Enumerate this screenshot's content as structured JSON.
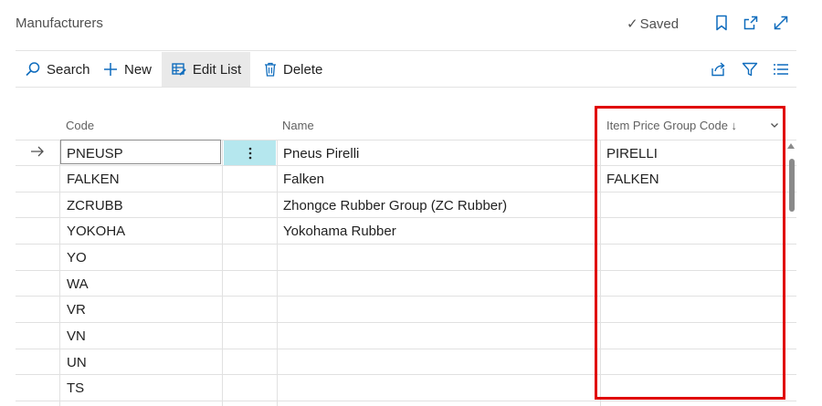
{
  "page": {
    "title": "Manufacturers",
    "saved_label": "Saved"
  },
  "toolbar": {
    "search_label": "Search",
    "new_label": "New",
    "edit_list_label": "Edit List",
    "delete_label": "Delete"
  },
  "table": {
    "columns": {
      "code": "Code",
      "name": "Name",
      "item_price_group_code": "Item Price Group Code ↓"
    },
    "rows": [
      {
        "code": "PNEUSP",
        "name": "Pneus Pirelli",
        "item_price_group_code": "PIRELLI"
      },
      {
        "code": "FALKEN",
        "name": "Falken",
        "item_price_group_code": "FALKEN"
      },
      {
        "code": "ZCRUBB",
        "name": "Zhongce Rubber Group (ZC Rubber)",
        "item_price_group_code": ""
      },
      {
        "code": "YOKOHA",
        "name": "Yokohama Rubber",
        "item_price_group_code": ""
      },
      {
        "code": "YO",
        "name": "",
        "item_price_group_code": ""
      },
      {
        "code": "WA",
        "name": "",
        "item_price_group_code": ""
      },
      {
        "code": "VR",
        "name": "",
        "item_price_group_code": ""
      },
      {
        "code": "VN",
        "name": "",
        "item_price_group_code": ""
      },
      {
        "code": "UN",
        "name": "",
        "item_price_group_code": ""
      },
      {
        "code": "TS",
        "name": "",
        "item_price_group_code": ""
      }
    ]
  },
  "colors": {
    "accent": "#0f6cbd",
    "selected_cell": "#b5e7ee",
    "highlight_border": "#e00000"
  }
}
